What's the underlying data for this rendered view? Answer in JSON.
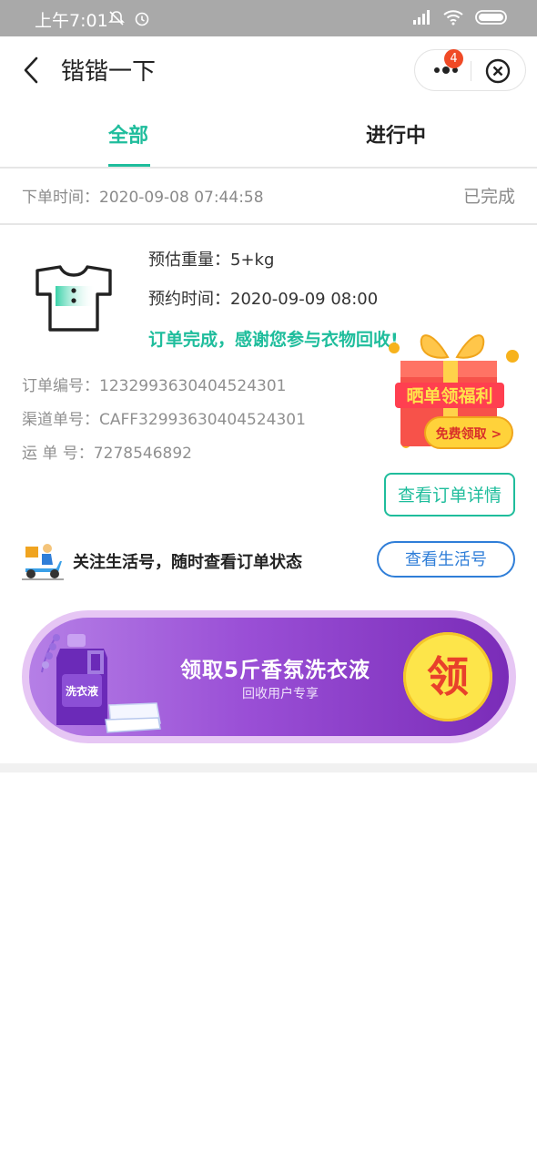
{
  "status_bar": {
    "time": "上午7:01"
  },
  "nav": {
    "title": "锴锴一下",
    "badge_count": "4"
  },
  "tabs": [
    {
      "label": "全部"
    },
    {
      "label": "进行中"
    }
  ],
  "order": {
    "time_text": "下单时间：2020-09-08 07:44:58",
    "status": "已完成",
    "estimated_weight": "预估重量：5+kg",
    "appointment_time": "预约时间：2020-09-09 08:00",
    "completion_message": "订单完成，感谢您参与衣物回收!",
    "order_number": "订单编号：1232993630404524301",
    "channel_number": "渠道单号：CAFF32993630404524301",
    "tracking_number": "运 单 号：7278546892",
    "detail_button": "查看订单详情"
  },
  "gift": {
    "title": "晒单领福利",
    "button": "免费领取 >"
  },
  "follow": {
    "text": "关注生活号，随时查看订单状态",
    "button": "查看生活号"
  },
  "banner": {
    "title": "领取5斤香氛洗衣液",
    "subtitle": "回收用户专享",
    "claim_label": "领",
    "product_label": "洗衣液"
  }
}
